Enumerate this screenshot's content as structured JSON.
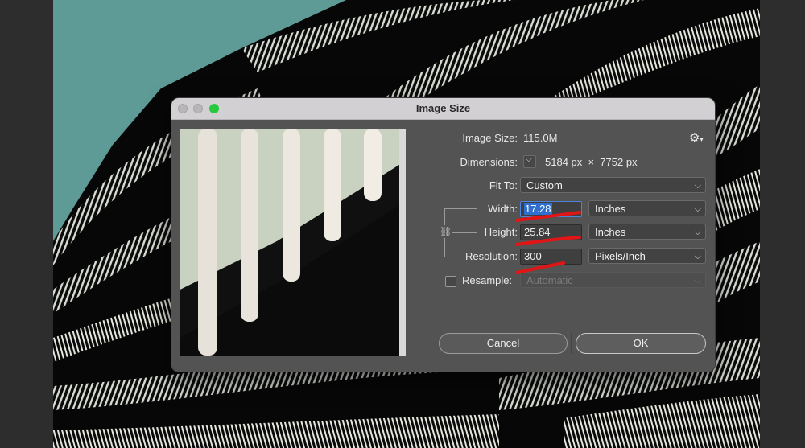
{
  "dialog": {
    "title": "Image Size",
    "image_size_label": "Image Size:",
    "image_size_value": "115.0M",
    "settings_icon": "gear-icon",
    "dimensions_label": "Dimensions:",
    "dimensions_value": "5184 px  ×  7752 px",
    "fit_to_label": "Fit To:",
    "fit_to_value": "Custom",
    "width_label": "Width:",
    "width_value": "17.28",
    "width_unit": "Inches",
    "height_label": "Height:",
    "height_value": "25.84",
    "height_unit": "Inches",
    "resolution_label": "Resolution:",
    "resolution_value": "300",
    "resolution_unit": "Pixels/Inch",
    "resample_label": "Resample:",
    "resample_checked": false,
    "resample_value": "Automatic",
    "cancel_label": "Cancel",
    "ok_label": "OK"
  },
  "colors": {
    "dialog_bg": "#535353",
    "titlebar_bg": "#d3d0d4",
    "highlight": "#2f6fcf",
    "annotation_red": "#e01515",
    "sky": "#5e9a96"
  }
}
